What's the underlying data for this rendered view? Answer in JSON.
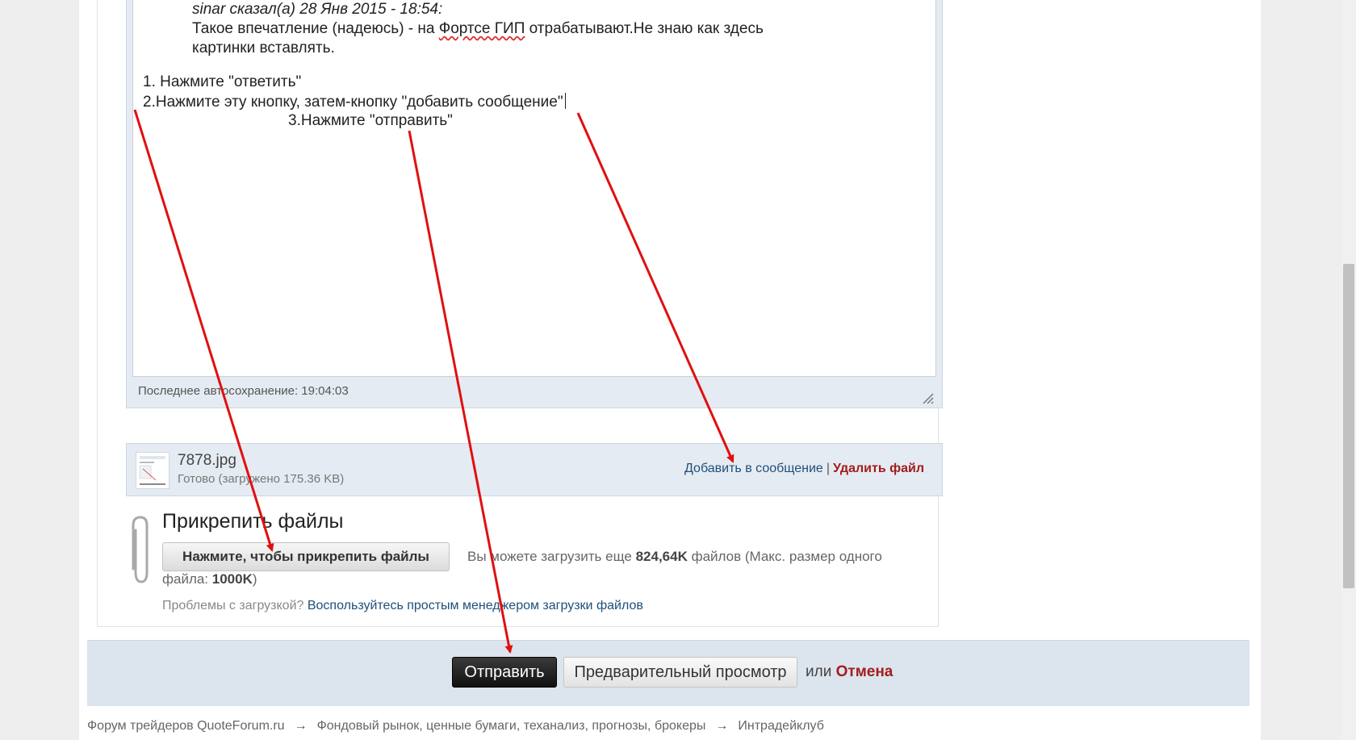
{
  "editor": {
    "quote_author": "sinar сказал(а) 28 Янв 2015 - 18:54:",
    "quote_line1_before": "Такое впечатление (надеюсь) - на ",
    "quote_line1_word": "Фортсе ГИП",
    "quote_line1_after": " отрабатывают.Не знаю как здесь",
    "quote_line2": "картинки вставлять.",
    "line1": "1. Нажмите \"ответить\"",
    "line2": "2.Нажмите эту кнопку, затем-кнопку \"добавить сообщение\"",
    "line3": "3.Нажмите \"отправить\"",
    "autosave": "Последнее автосохранение: 19:04:03"
  },
  "file": {
    "name": "7878.jpg",
    "status": "Готово (загружено 175.36 KB)",
    "add_label": "Добавить в сообщение",
    "separator": "|",
    "delete_label": "Удалить файл"
  },
  "attach": {
    "title": "Прикрепить файлы",
    "button_label": "Нажмите, чтобы прикрепить файлы",
    "quota_before": "Вы можете загрузить еще ",
    "quota_amount": "824,64K",
    "quota_middle": " файлов (Макс. размер одного файла: ",
    "quota_max": "1000K",
    "quota_after": ")",
    "problems_text": "Проблемы с загрузкой? ",
    "problems_link": "Воспользуйтесь простым менеджером загрузки файлов"
  },
  "actions": {
    "submit_label": "Отправить",
    "preview_label": "Предварительный просмотр",
    "or_text": "или",
    "cancel_label": "Отмена"
  },
  "breadcrumb": {
    "items": [
      "Форум трейдеров QuoteForum.ru",
      "Фондовый рынок, ценные бумаги, теханализ, прогнозы, брокеры",
      "Интрадейклуб"
    ],
    "arrow": "→"
  },
  "colors": {
    "annotation_arrow": "#e01010",
    "link": "#1e4f7a",
    "danger_link": "#a11d1d",
    "submit_bar": "#dce4ee"
  },
  "icons": [
    "paperclip-icon",
    "resize-handle-icon",
    "file-thumbnail-icon"
  ]
}
